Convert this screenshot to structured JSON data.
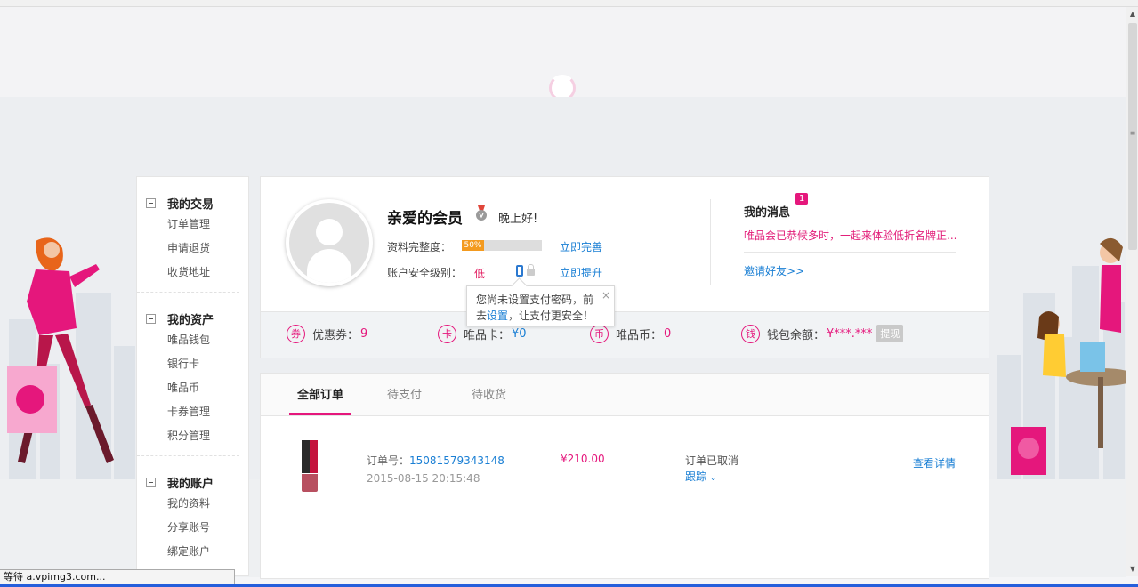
{
  "bookmarks": [
    "",
    "",
    "",
    "",
    "",
    "",
    ""
  ],
  "sidebar": {
    "groups": [
      {
        "title": "我的交易",
        "items": [
          "订单管理",
          "申请退货",
          "收货地址"
        ]
      },
      {
        "title": "我的资产",
        "items": [
          "唯品钱包",
          "银行卡",
          "唯品币",
          "卡券管理",
          "积分管理"
        ]
      },
      {
        "title": "我的账户",
        "items": [
          "我的资料",
          "分享账号",
          "绑定账户"
        ]
      }
    ]
  },
  "profile": {
    "name": "亲爱的会员",
    "greeting": "晚上好!",
    "completeness_label": "资料完整度：",
    "completeness_value": "50%",
    "completeness_fraction": 0.5,
    "complete_link": "立即完善",
    "security_label": "账户安全级别：",
    "security_level": "低",
    "upgrade_link": "立即提升"
  },
  "messages": {
    "title": "我的消息",
    "badge": "1",
    "text": "唯品会已恭候多时，一起来体验低折名牌正...",
    "invite": "邀请好友>>"
  },
  "assets": {
    "coupon": {
      "icon": "券",
      "label": "优惠券：",
      "value": "9"
    },
    "card": {
      "icon": "卡",
      "label": "唯品卡：",
      "value": "¥0"
    },
    "coin": {
      "icon": "币",
      "label": "唯品币：",
      "value": "0"
    },
    "wallet": {
      "icon": "钱",
      "label": "钱包余额：",
      "value": "¥***.***",
      "withdraw": "提现"
    }
  },
  "tooltip": {
    "line1": "您尚未设置支付密码，前",
    "line2_pre": "去",
    "line2_link": "设置",
    "line2_post": "，让支付更安全！",
    "close": "×"
  },
  "orders": {
    "tabs": [
      "全部订单",
      "待支付",
      "待收货"
    ],
    "active_tab": 0,
    "rows": [
      {
        "order_label": "订单号：",
        "order_no": "15081579343148",
        "date": "2015-08-15 20:15:48",
        "price": "¥210.00",
        "status": "订单已取消",
        "trace": "跟踪",
        "detail": "查看详情"
      }
    ]
  },
  "statusbar": {
    "text": "等待 a.vpimg3.com..."
  },
  "colors": {
    "accent": "#e5177c",
    "link": "#1a7fd4",
    "progress": "#f39a1f"
  }
}
